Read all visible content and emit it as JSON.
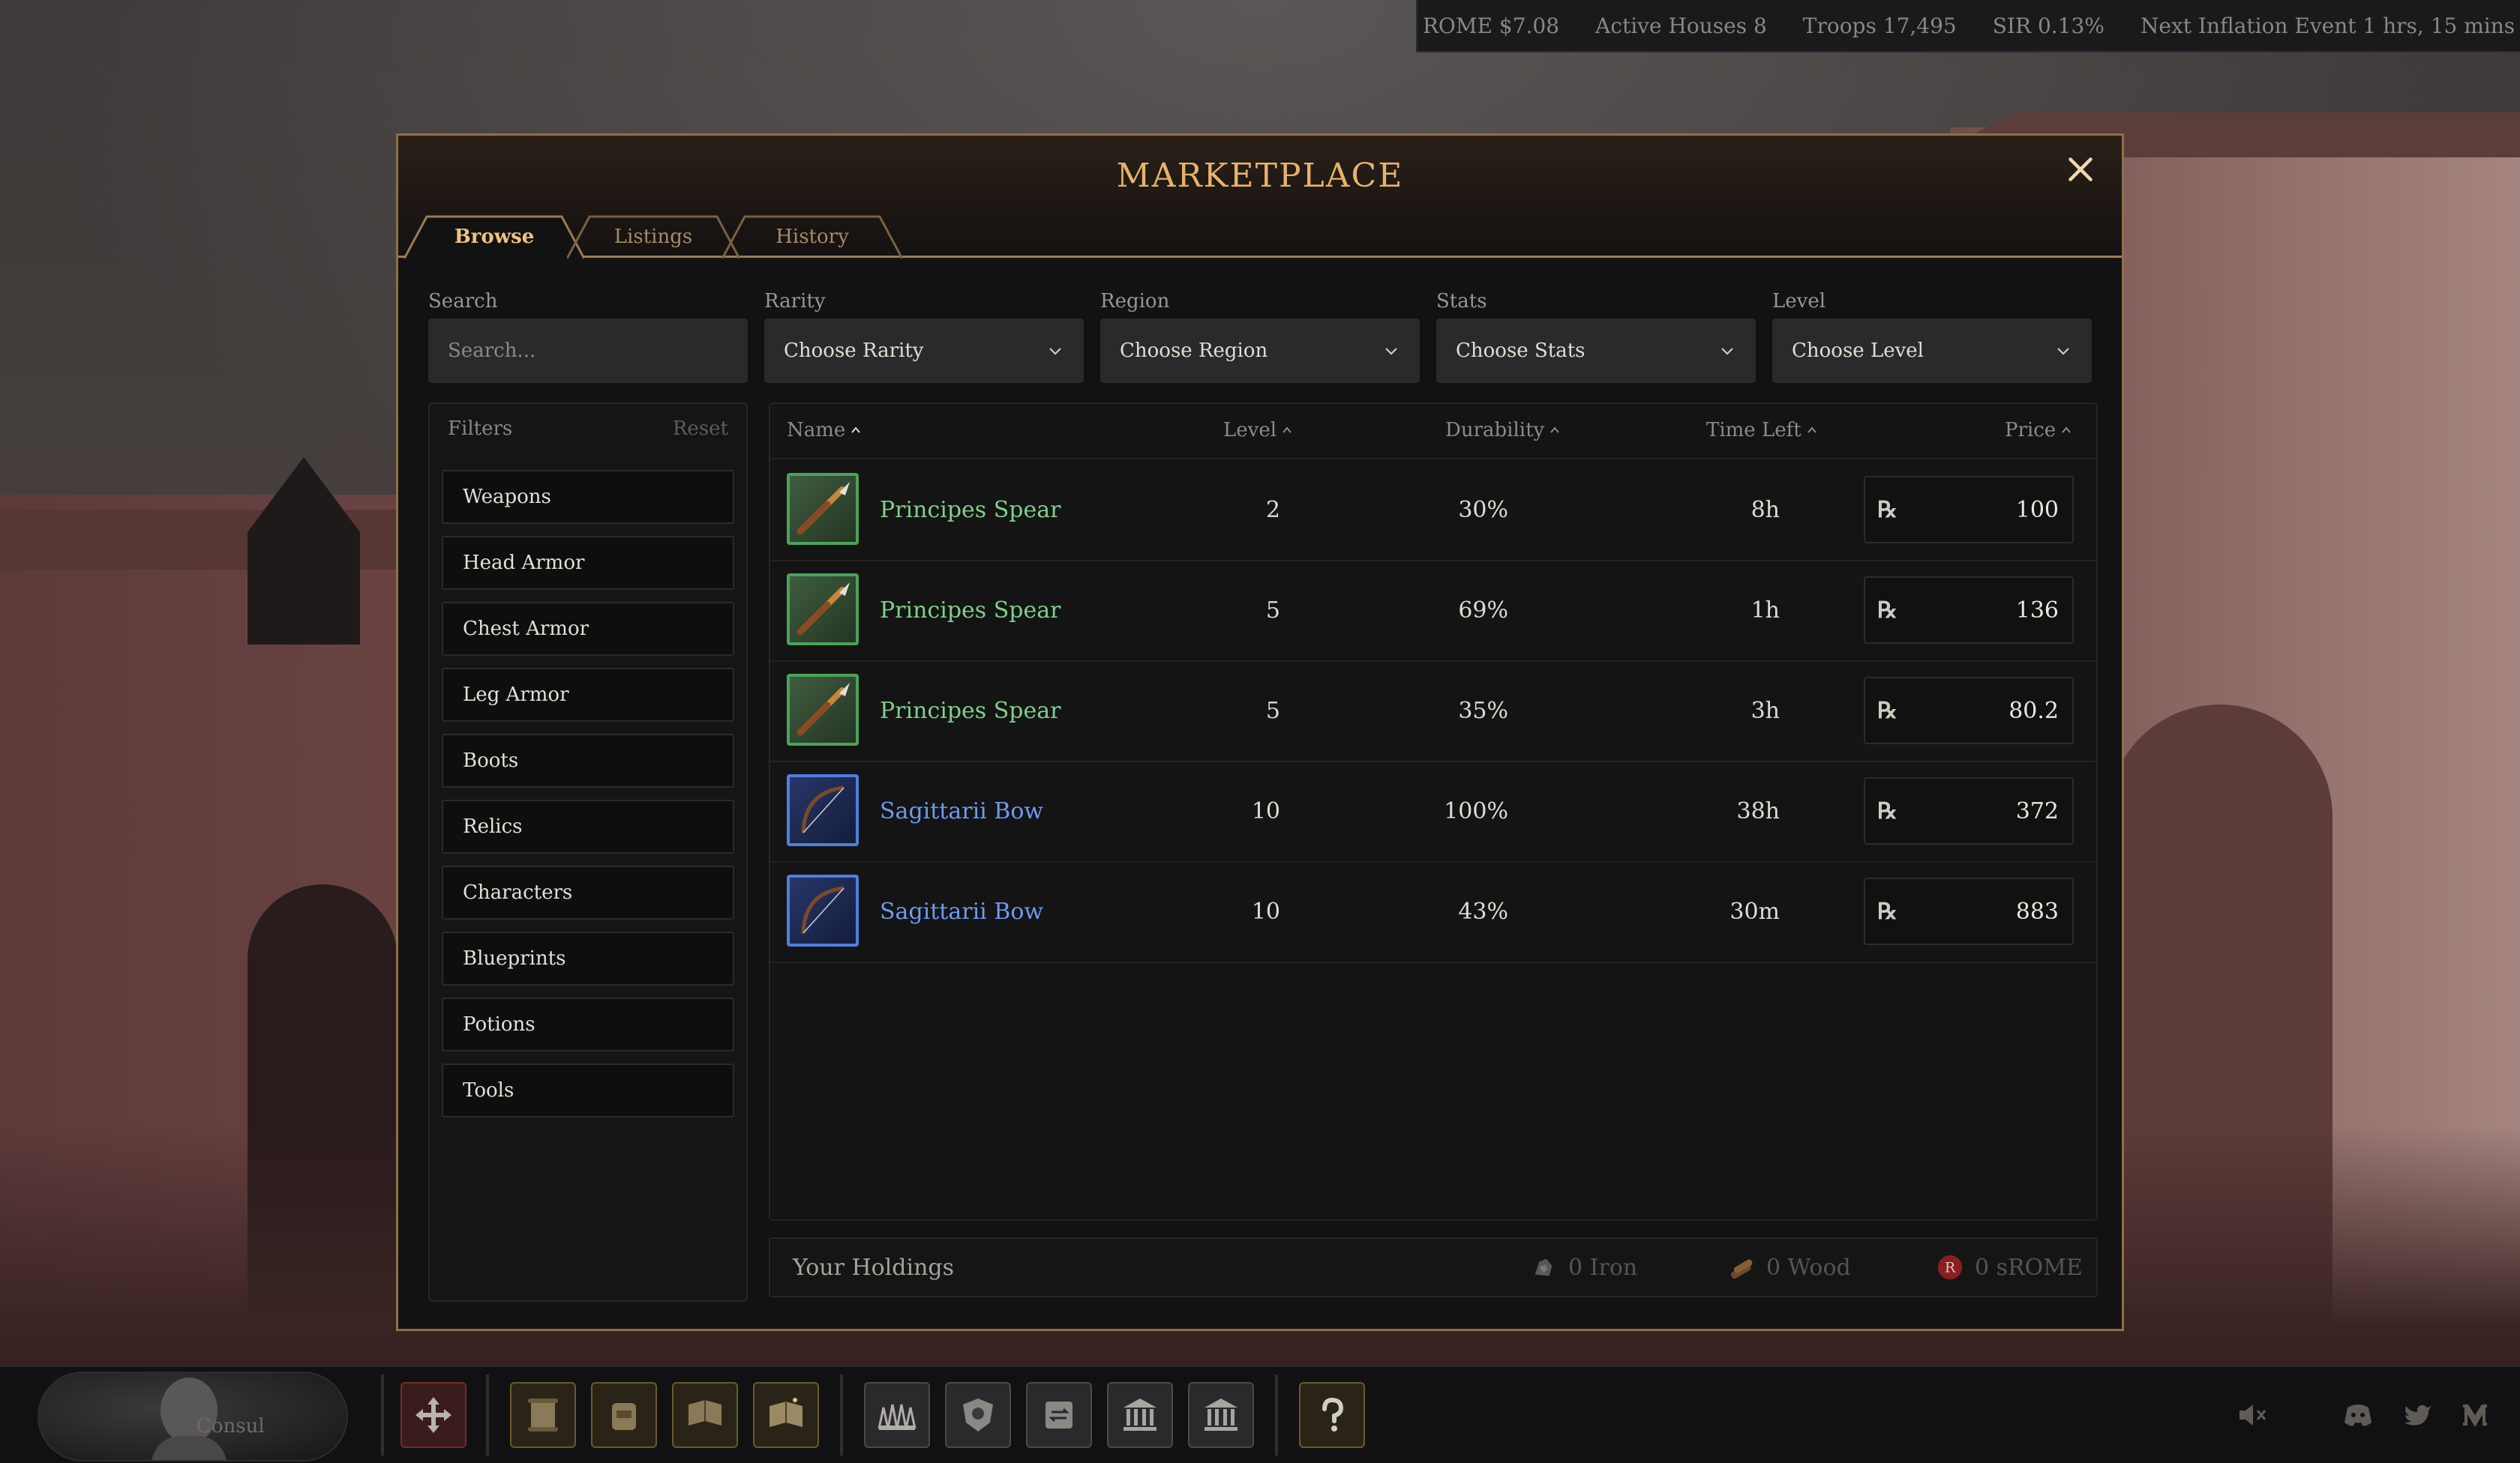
{
  "topbar": {
    "rome": "ROME $7.08",
    "houses": "Active Houses 8",
    "troops": "Troops 17,495",
    "sir": "SIR 0.13%",
    "inflation": "Next Inflation Event 1 hrs, 15 mins"
  },
  "modal": {
    "title": "MARKETPLACE",
    "close_icon": "close-icon"
  },
  "tabs": [
    {
      "label": "Browse",
      "active": true
    },
    {
      "label": "Listings",
      "active": false
    },
    {
      "label": "History",
      "active": false
    }
  ],
  "fields": {
    "search_label": "Search",
    "search_placeholder": "Search...",
    "rarity_label": "Rarity",
    "rarity_value": "Choose Rarity",
    "region_label": "Region",
    "region_value": "Choose Region",
    "stats_label": "Stats",
    "stats_value": "Choose Stats",
    "level_label": "Level",
    "level_value": "Choose Level"
  },
  "filters": {
    "title": "Filters",
    "reset": "Reset",
    "categories": [
      "Weapons",
      "Head Armor",
      "Chest Armor",
      "Leg Armor",
      "Boots",
      "Relics",
      "Characters",
      "Blueprints",
      "Potions",
      "Tools"
    ]
  },
  "table": {
    "headers": {
      "name": "Name",
      "level": "Level",
      "durability": "Durability",
      "time_left": "Time Left",
      "price": "Price"
    },
    "currency_symbol": "℞",
    "rows": [
      {
        "name": "Principes Spear",
        "level": "2",
        "durability": "30%",
        "time_left": "8h",
        "price": "100",
        "rarity_color": "#7fd08a",
        "icon": "spear-icon"
      },
      {
        "name": "Principes Spear",
        "level": "5",
        "durability": "69%",
        "time_left": "1h",
        "price": "136",
        "rarity_color": "#7fd08a",
        "icon": "spear-icon"
      },
      {
        "name": "Principes Spear",
        "level": "5",
        "durability": "35%",
        "time_left": "3h",
        "price": "80.2",
        "rarity_color": "#7fd08a",
        "icon": "spear-icon"
      },
      {
        "name": "Sagittarii Bow",
        "level": "10",
        "durability": "100%",
        "time_left": "38h",
        "price": "372",
        "rarity_color": "#6d9bf0",
        "icon": "bow-icon"
      },
      {
        "name": "Sagittarii Bow",
        "level": "10",
        "durability": "43%",
        "time_left": "30m",
        "price": "883",
        "rarity_color": "#6d9bf0",
        "icon": "bow-icon"
      }
    ]
  },
  "holdings": {
    "label": "Your Holdings",
    "iron": "0  Iron",
    "wood": "0  Wood",
    "srome": "0  sROME"
  },
  "bottombar": {
    "portrait_label": "Consul"
  },
  "colors": {
    "accent_gold": "#e6b36a",
    "common_green": "#7fd08a",
    "rare_blue": "#6d9bf0"
  }
}
